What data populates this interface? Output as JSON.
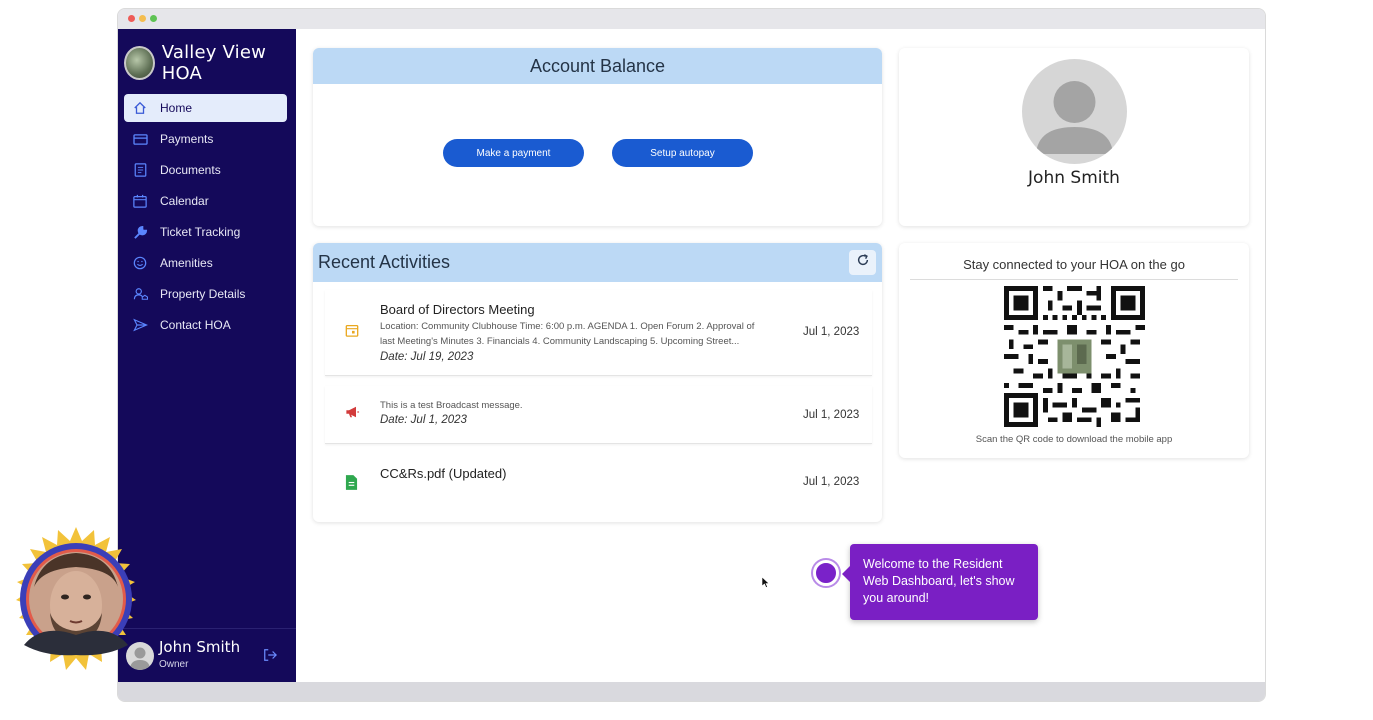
{
  "sidebar": {
    "brand": "Valley View HOA",
    "items": [
      {
        "label": "Home",
        "icon": "home-icon"
      },
      {
        "label": "Payments",
        "icon": "credit-card-icon"
      },
      {
        "label": "Documents",
        "icon": "document-icon"
      },
      {
        "label": "Calendar",
        "icon": "calendar-icon"
      },
      {
        "label": "Ticket Tracking",
        "icon": "wrench-icon"
      },
      {
        "label": "Amenities",
        "icon": "smiley-icon"
      },
      {
        "label": "Property Details",
        "icon": "user-house-icon"
      },
      {
        "label": "Contact HOA",
        "icon": "send-icon"
      }
    ],
    "footer": {
      "name": "John Smith",
      "role": "Owner"
    }
  },
  "account_balance": {
    "title": "Account Balance",
    "pay_label": "Make a payment",
    "autopay_label": "Setup autopay"
  },
  "profile": {
    "name": "John Smith"
  },
  "activities": {
    "title": "Recent Activities",
    "items": [
      {
        "icon": "calendar-event-icon",
        "title": "Board of Directors Meeting",
        "body_line1": "Location: Community Clubhouse Time: 6:00 p.m. AGENDA 1. Open Forum 2. Approval of",
        "body_line2": "last Meeting's Minutes 3. Financials 4. Community Landscaping 5. Upcoming Street...",
        "date": "Date: Jul 19, 2023",
        "right_date": "Jul 1, 2023"
      },
      {
        "icon": "megaphone-icon",
        "body_line1": "This is a test Broadcast message.",
        "date": "Date: Jul 1, 2023",
        "right_date": "Jul 1, 2023"
      },
      {
        "icon": "file-icon",
        "title": "CC&Rs.pdf (Updated)",
        "right_date": "Jul 1, 2023"
      }
    ]
  },
  "qr": {
    "title": "Stay connected to your HOA on the go",
    "caption": "Scan the QR code to download the mobile app"
  },
  "tour": {
    "line1": "Welcome to the Resident",
    "line2": "Web Dashboard, let's show",
    "line3": "you around!"
  },
  "colors": {
    "sidebar": "#14095a",
    "accent": "#1a5bd1",
    "header_bg": "#bcd9f5",
    "tour": "#7a1fc4"
  }
}
